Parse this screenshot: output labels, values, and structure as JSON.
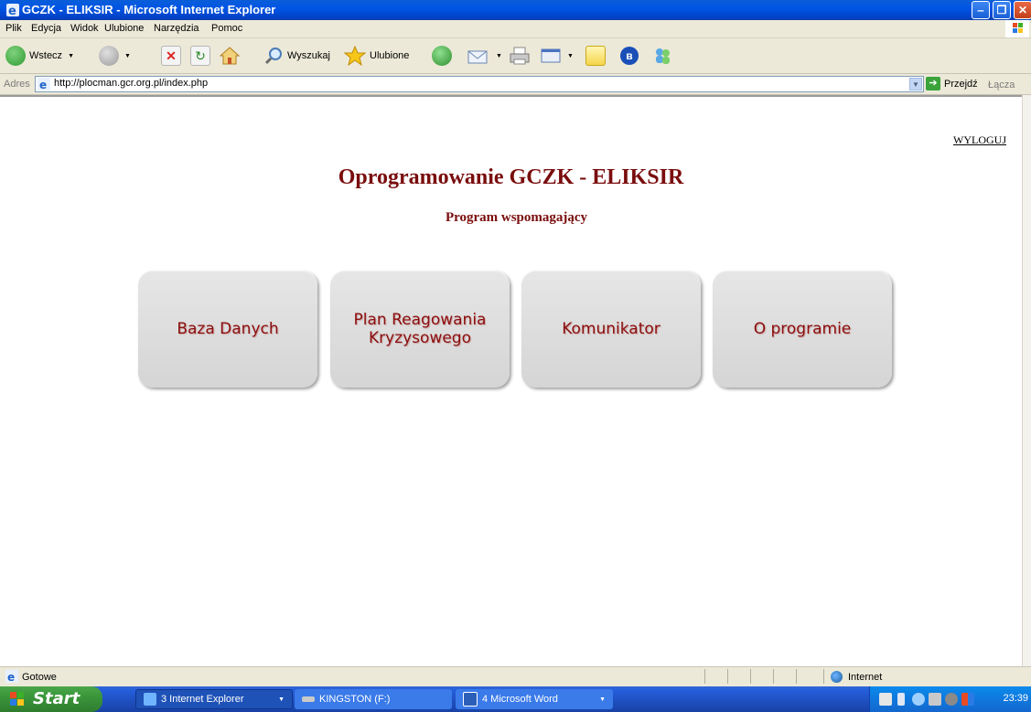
{
  "window": {
    "title": "GCZK - ELIKSIR - Microsoft Internet Explorer",
    "minimize": "‒",
    "maximize": "❐",
    "close": "✕"
  },
  "menu": [
    "Plik",
    "Edycja",
    "Widok",
    "Ulubione",
    "Narzędzia",
    "Pomoc"
  ],
  "toolbar": {
    "back_label": "Wstecz",
    "search_label": "Wyszukaj",
    "favorites_label": "Ulubione"
  },
  "address": {
    "label": "Adres",
    "url": "http://plocman.gcr.org.pl/index.php",
    "go_label": "Przejdź",
    "links_label": "Łącza"
  },
  "page": {
    "logout": "WYLOGUJ",
    "title": "Oprogramowanie GCZK - ELIKSIR",
    "subtitle": "Program wspomagający",
    "tiles": [
      {
        "label": "Baza Danych"
      },
      {
        "label": "Plan Reagowania\nKryzysowego"
      },
      {
        "label": "Komunikator"
      },
      {
        "label": "O programie"
      }
    ]
  },
  "status": {
    "text": "Gotowe",
    "zone": "Internet"
  },
  "taskbar": {
    "start": "Start",
    "tasks": [
      {
        "label": "3 Internet Explorer"
      },
      {
        "label": "KINGSTON (F:)"
      },
      {
        "label": "4 Microsoft Word"
      }
    ],
    "clock": "23:39"
  },
  "colors": {
    "heading": "#7a0d0d",
    "tile_text": "#8b0e0e",
    "tile_bg": "#dedede"
  }
}
